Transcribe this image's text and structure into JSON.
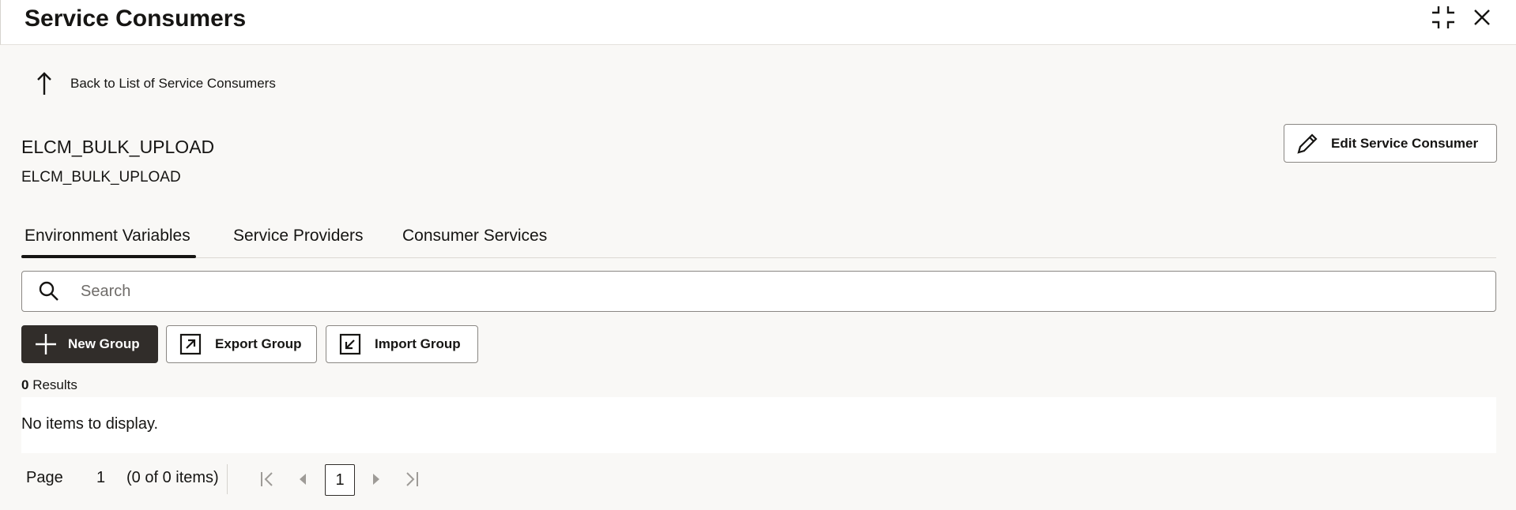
{
  "header": {
    "title": "Service Consumers",
    "icons": {
      "collapse": "collapse-icon",
      "close": "close-icon"
    }
  },
  "back": {
    "label": "Back to List of Service Consumers",
    "icon": "arrow-up-icon"
  },
  "consumer": {
    "name": "ELCM_BULK_UPLOAD",
    "description": "ELCM_BULK_UPLOAD"
  },
  "actions": {
    "edit_label": "Edit Service Consumer",
    "edit_icon": "pencil-icon"
  },
  "tabs": [
    {
      "label": "Environment Variables",
      "selected": true
    },
    {
      "label": "Service Providers",
      "selected": false
    },
    {
      "label": "Consumer Services",
      "selected": false
    }
  ],
  "search": {
    "placeholder": "Search",
    "value": ""
  },
  "toolbar": {
    "new_group_label": "New Group",
    "export_group_label": "Export Group",
    "import_group_label": "Import Group"
  },
  "results": {
    "count": "0",
    "label": "Results"
  },
  "table": {
    "empty_message": "No items to display."
  },
  "pagination": {
    "page_label": "Page",
    "current_page": "1",
    "summary": "(0 of 0 items)",
    "page_button": "1"
  }
}
